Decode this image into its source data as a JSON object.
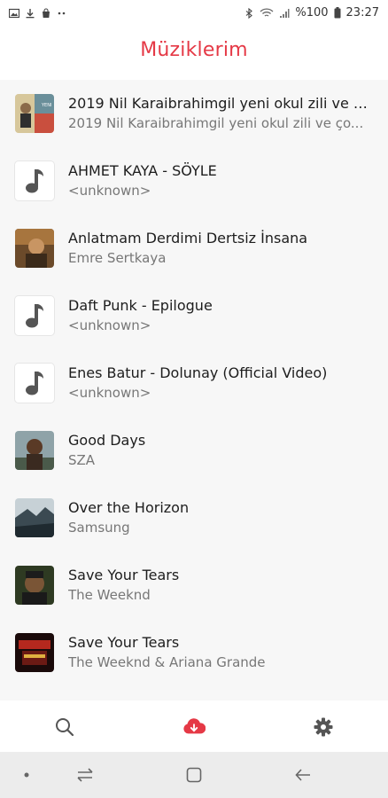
{
  "status_bar": {
    "battery": "%100",
    "time": "23:27"
  },
  "header": {
    "title": "Müziklerim"
  },
  "songs": [
    {
      "title": "2019 Nil Karaibrahimgil yeni okul zili ve ço...",
      "artist": "2019 Nil Karaibrahimgil yeni okul zili ve ço...",
      "thumb": "album-art"
    },
    {
      "title": "AHMET KAYA - SÖYLE",
      "artist": "<unknown>",
      "thumb": "music-note-icon"
    },
    {
      "title": "Anlatmam Derdimi Dertsiz İnsana",
      "artist": "Emre Sertkaya",
      "thumb": "album-art"
    },
    {
      "title": "Daft Punk - Epilogue",
      "artist": "<unknown>",
      "thumb": "music-note-icon"
    },
    {
      "title": "Enes Batur - Dolunay (Official Video)",
      "artist": "<unknown>",
      "thumb": "music-note-icon"
    },
    {
      "title": "Good Days",
      "artist": "SZA",
      "thumb": "album-art"
    },
    {
      "title": "Over the Horizon",
      "artist": "Samsung",
      "thumb": "album-art"
    },
    {
      "title": "Save Your Tears",
      "artist": "The Weeknd",
      "thumb": "album-art"
    },
    {
      "title": "Save Your Tears",
      "artist": "The Weeknd & Ariana Grande",
      "thumb": "album-art"
    }
  ],
  "bottom_nav": {
    "items": [
      "search-icon",
      "cloud-download-icon",
      "settings-gear-icon"
    ],
    "active": "cloud-download-icon"
  },
  "colors": {
    "accent": "#e53946",
    "list_background": "#f7f7f7",
    "icon_gray": "#555555"
  }
}
